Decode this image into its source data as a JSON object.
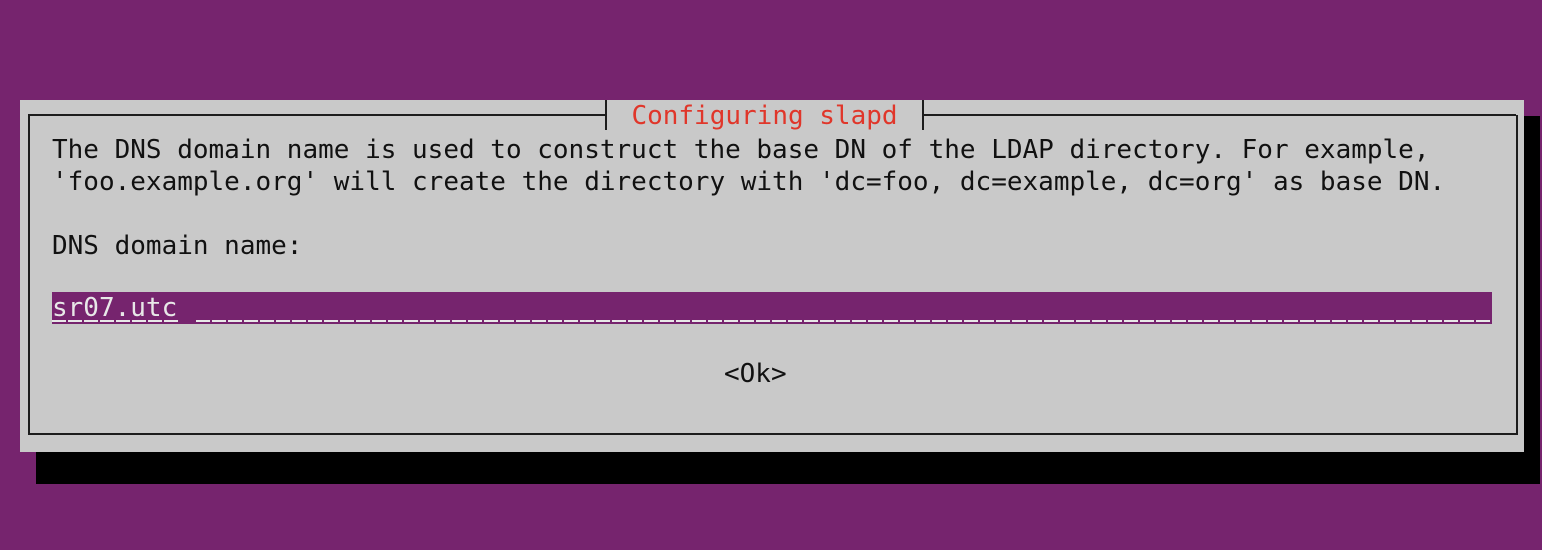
{
  "dialog": {
    "title": "Configuring slapd",
    "description_line1": "The DNS domain name is used to construct the base DN of the LDAP directory. For example,",
    "description_line2": "'foo.example.org' will create the directory with 'dc=foo, dc=example, dc=org' as base DN.",
    "field_label": "DNS domain name:",
    "field_value": "sr07.utc",
    "ok_label": "<Ok>"
  },
  "colors": {
    "background": "#76246e",
    "dialog": "#c9c9c9",
    "title": "#e0362a",
    "input_bg": "#76246e"
  }
}
